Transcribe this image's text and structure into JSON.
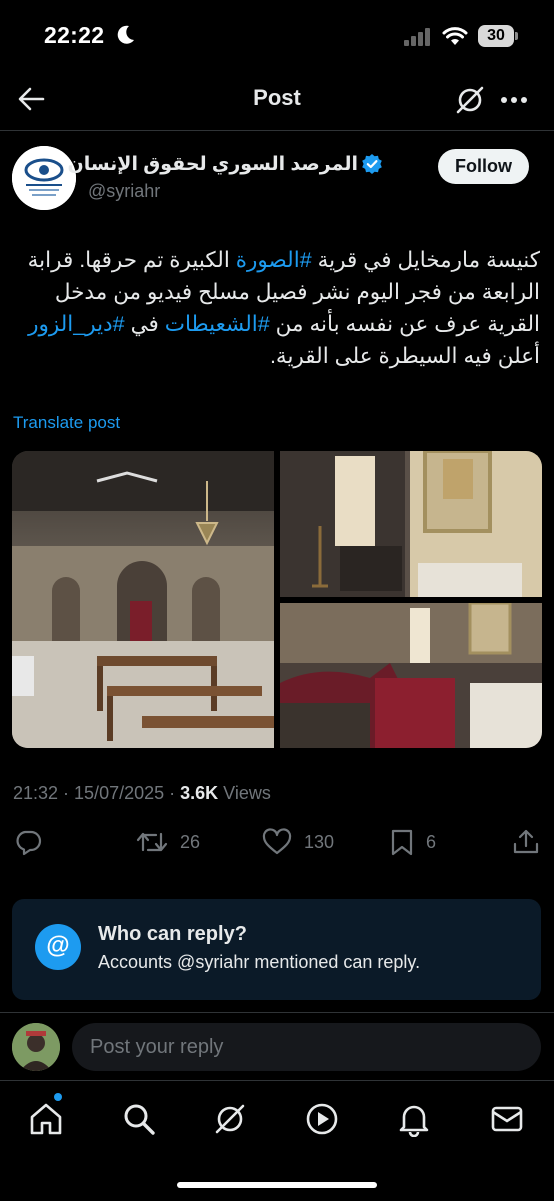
{
  "status_bar": {
    "time": "22:22",
    "battery": "30",
    "icons": [
      "moon-icon",
      "signal-icon",
      "wifi-icon",
      "battery-icon"
    ]
  },
  "header": {
    "title": "Post",
    "icons": [
      "back-arrow-icon",
      "grok-icon",
      "more-icon"
    ]
  },
  "author": {
    "name": "المرصد السوري لحقوق الإنسان",
    "handle": "@syriahr",
    "verified": true,
    "follow_label": "Follow"
  },
  "post": {
    "text_parts": [
      {
        "t": "كنيسة مارمخايل في قرية ",
        "tag": false
      },
      {
        "t": "#الصورة",
        "tag": true
      },
      {
        "t": " الكبيرة تم حرقها. قرابة الرابعة من فجر اليوم نشر فصيل مسلح فيديو من مدخل القرية عرف عن نفسه بأنه من ",
        "tag": false
      },
      {
        "t": "#الشعيطات",
        "tag": true
      },
      {
        "t": " في ",
        "tag": false
      },
      {
        "t": "#دير_الزور",
        "tag": true
      },
      {
        "t": " أعلن فيه السيطرة على القرية.",
        "tag": false
      }
    ],
    "translate_label": "Translate post",
    "media_count": 3,
    "timestamp": "21:32 · 15/07/2025 · ",
    "views_count": "3.6K",
    "views_label": " Views"
  },
  "actions": {
    "reply": "",
    "reposts": "26",
    "likes": "130",
    "bookmarks": "6"
  },
  "reply_settings": {
    "icon_label": "@",
    "title": "Who can reply?",
    "subtitle": "Accounts @syriahr mentioned can reply."
  },
  "composer": {
    "placeholder": "Post your reply"
  },
  "bottom_nav": [
    "home-icon",
    "search-icon",
    "grok-icon",
    "video-icon",
    "notifications-icon",
    "messages-icon"
  ],
  "colors": {
    "accent": "#1d9bf0",
    "background": "#000000",
    "muted": "#71767b",
    "text": "#e7e9ea",
    "card": "#0b1a28"
  }
}
